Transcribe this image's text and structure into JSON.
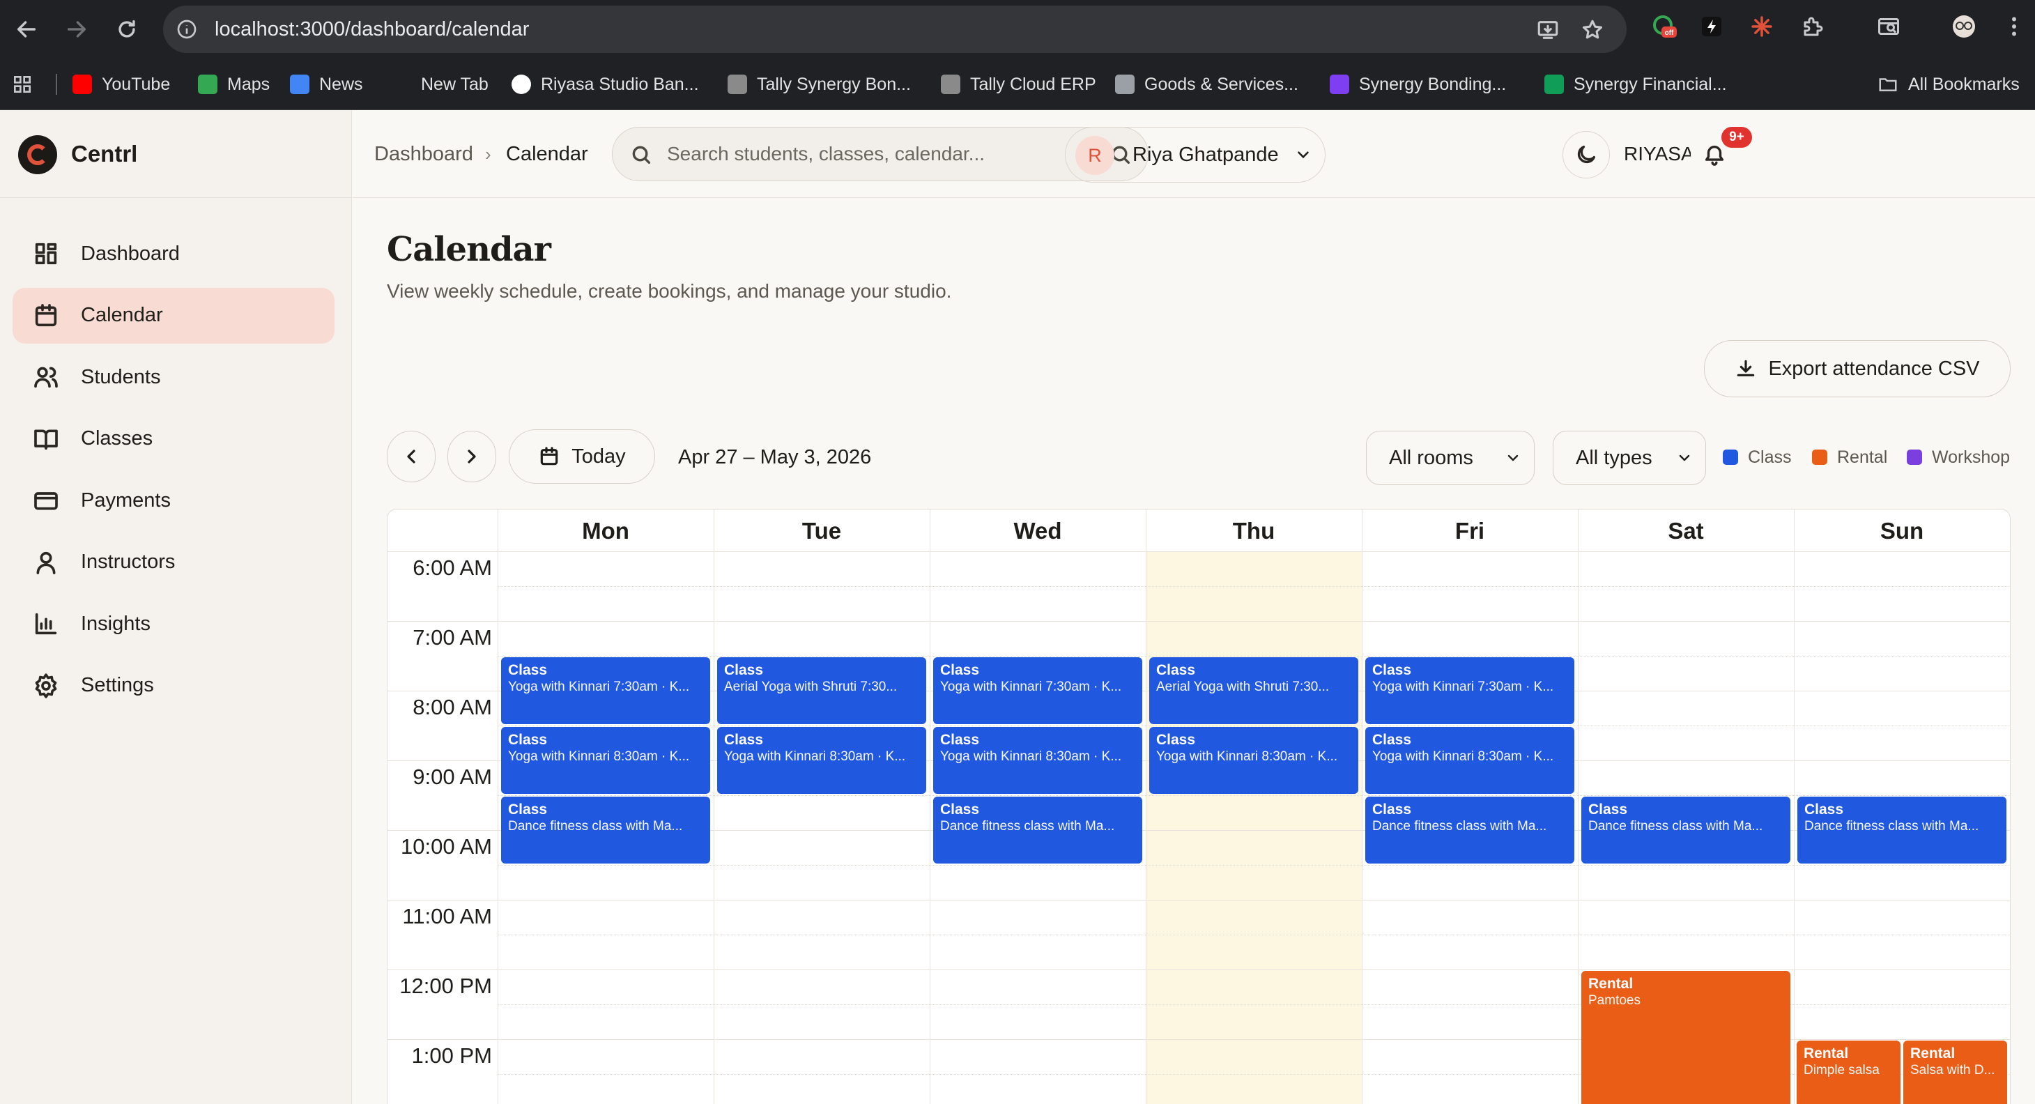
{
  "browser": {
    "url": "localhost:3000/dashboard/calendar",
    "ext_badge": "off",
    "bookmarks": [
      {
        "label": "YouTube",
        "color": "#ff0000"
      },
      {
        "label": "Maps",
        "color": "#34a853"
      },
      {
        "label": "News",
        "color": "#4285f4"
      },
      {
        "label": "New Tab",
        "color": ""
      },
      {
        "label": "Riyasa Studio Ban...",
        "color": "#ffffff"
      },
      {
        "label": "Tally Synergy Bon...",
        "color": "#8a8a8a"
      },
      {
        "label": "Tally Cloud ERP",
        "color": "#8a8a8a"
      },
      {
        "label": "Goods & Services...",
        "color": "#9aa0a6"
      },
      {
        "label": "Synergy Bonding...",
        "color": "#7e3ff2"
      },
      {
        "label": "Synergy Financial...",
        "color": "#0f9d58"
      }
    ],
    "all_bookmarks": "All Bookmarks"
  },
  "app": {
    "brand": "Centrl",
    "accent": "#e0523a",
    "nav": [
      {
        "label": "Dashboard",
        "icon": "grid-icon",
        "active": false
      },
      {
        "label": "Calendar",
        "icon": "calendar-icon",
        "active": true
      },
      {
        "label": "Students",
        "icon": "users-icon",
        "active": false
      },
      {
        "label": "Classes",
        "icon": "book-icon",
        "active": false
      },
      {
        "label": "Payments",
        "icon": "card-icon",
        "active": false
      },
      {
        "label": "Instructors",
        "icon": "user-icon",
        "active": false
      },
      {
        "label": "Insights",
        "icon": "bar-chart-icon",
        "active": false
      },
      {
        "label": "Settings",
        "icon": "gear-icon",
        "active": false
      }
    ]
  },
  "header": {
    "breadcrumb": [
      "Dashboard",
      "Calendar"
    ],
    "search_placeholder": "Search students, classes, calendar...",
    "studio": "RIYASA",
    "notifications_badge": "9+",
    "user_initial": "R",
    "user_name": "Riya Ghatpande"
  },
  "page": {
    "title": "Calendar",
    "subtitle": "View weekly schedule, create bookings, and manage your studio.",
    "export_label": "Export attendance CSV",
    "today_label": "Today",
    "range": "Apr 27 – May 3, 2026",
    "rooms_filter": "All rooms",
    "types_filter": "All types",
    "legend": [
      {
        "label": "Class",
        "color": "#2158e0"
      },
      {
        "label": "Rental",
        "color": "#ea5d16"
      },
      {
        "label": "Workshop",
        "color": "#7b3fe0"
      }
    ]
  },
  "calendar": {
    "days": [
      "Mon",
      "Tue",
      "Wed",
      "Thu",
      "Fri",
      "Sat",
      "Sun"
    ],
    "today_index": 3,
    "times": [
      "6:00 AM",
      "7:00 AM",
      "8:00 AM",
      "9:00 AM",
      "10:00 AM",
      "11:00 AM",
      "12:00 PM",
      "1:00 PM"
    ],
    "events": [
      {
        "day": 0,
        "start": 7.5,
        "end": 8.5,
        "type": "Class",
        "title": "Yoga with Kinnari 7:30am · K..."
      },
      {
        "day": 0,
        "start": 8.5,
        "end": 9.5,
        "type": "Class",
        "title": "Yoga with Kinnari 8:30am · K..."
      },
      {
        "day": 0,
        "start": 9.5,
        "end": 10.5,
        "type": "Class",
        "title": "Dance fitness class with Ma..."
      },
      {
        "day": 1,
        "start": 7.5,
        "end": 8.5,
        "type": "Class",
        "title": "Aerial Yoga with Shruti 7:30..."
      },
      {
        "day": 1,
        "start": 8.5,
        "end": 9.5,
        "type": "Class",
        "title": "Yoga with Kinnari 8:30am · K..."
      },
      {
        "day": 2,
        "start": 7.5,
        "end": 8.5,
        "type": "Class",
        "title": "Yoga with Kinnari 7:30am · K..."
      },
      {
        "day": 2,
        "start": 8.5,
        "end": 9.5,
        "type": "Class",
        "title": "Yoga with Kinnari 8:30am · K..."
      },
      {
        "day": 2,
        "start": 9.5,
        "end": 10.5,
        "type": "Class",
        "title": "Dance fitness class with Ma..."
      },
      {
        "day": 3,
        "start": 7.5,
        "end": 8.5,
        "type": "Class",
        "title": "Aerial Yoga with Shruti 7:30..."
      },
      {
        "day": 3,
        "start": 8.5,
        "end": 9.5,
        "type": "Class",
        "title": "Yoga with Kinnari 8:30am · K..."
      },
      {
        "day": 4,
        "start": 7.5,
        "end": 8.5,
        "type": "Class",
        "title": "Yoga with Kinnari 7:30am · K..."
      },
      {
        "day": 4,
        "start": 8.5,
        "end": 9.5,
        "type": "Class",
        "title": "Yoga with Kinnari 8:30am · K..."
      },
      {
        "day": 4,
        "start": 9.5,
        "end": 10.5,
        "type": "Class",
        "title": "Dance fitness class with Ma..."
      },
      {
        "day": 5,
        "start": 9.5,
        "end": 10.5,
        "type": "Class",
        "title": "Dance fitness class with Ma..."
      },
      {
        "day": 6,
        "start": 9.5,
        "end": 10.5,
        "type": "Class",
        "title": "Dance fitness class with Ma..."
      },
      {
        "day": 5,
        "start": 12,
        "end": 14,
        "type": "Rental",
        "title": "Pamtoes"
      },
      {
        "day": 6,
        "start": 13,
        "end": 14,
        "type": "Rental",
        "title": "Dimple salsa",
        "half": 0
      },
      {
        "day": 6,
        "start": 13,
        "end": 14,
        "type": "Rental",
        "title": "Salsa with D...",
        "half": 1
      }
    ]
  }
}
